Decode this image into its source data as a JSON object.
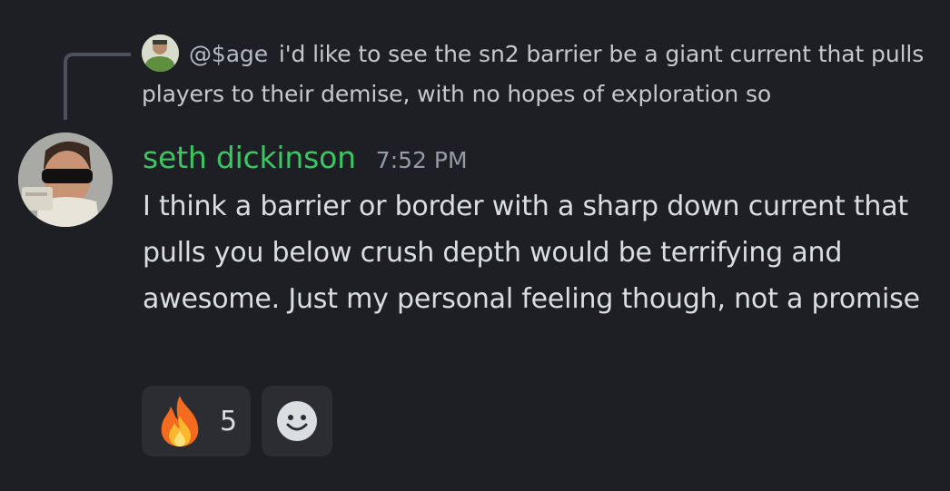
{
  "reply": {
    "username": "@$age",
    "text": "i'd like to see the sn2 barrier be a giant current that pulls players to their demise, with no hopes of exploration so"
  },
  "message": {
    "username": "seth dickinson",
    "timestamp": "7:52 PM",
    "text": "I think a barrier or border with a sharp down current that pulls you below crush depth would be terrifying and awesome. Just my personal feeling though, not a promise"
  },
  "reactions": [
    {
      "emoji_icon": "fire-emoji",
      "count": "5"
    }
  ],
  "add_reaction_icon": "smiley-add-reaction-icon",
  "colors": {
    "background": "#1e1f24",
    "username": "#3cc565",
    "reaction_bg": "#2b2d33",
    "timestamp": "#949ba4"
  }
}
